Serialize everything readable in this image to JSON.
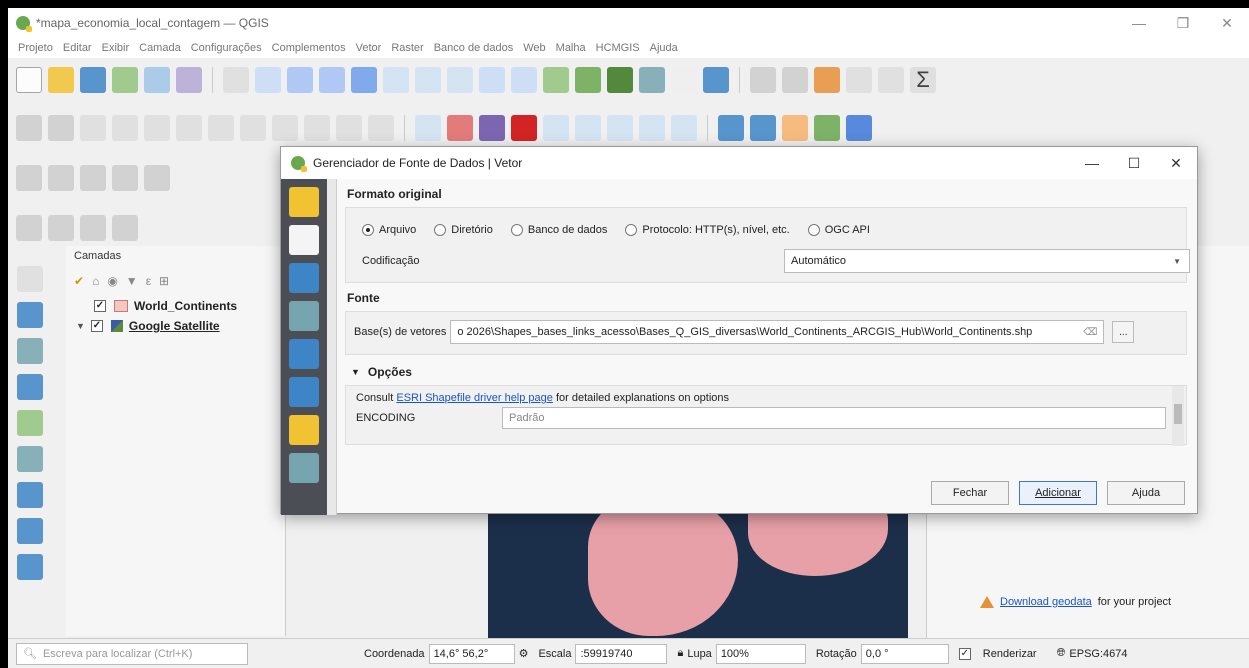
{
  "window": {
    "title": "*mapa_economia_local_contagem — QGIS"
  },
  "menu": [
    "Projeto",
    "Editar",
    "Exibir",
    "Camada",
    "Configurações",
    "Complementos",
    "Vetor",
    "Raster",
    "Banco de dados",
    "Web",
    "Malha",
    "HCMGIS",
    "Ajuda"
  ],
  "layers_panel": {
    "title": "Camadas",
    "layers": [
      {
        "name": "World_Continents",
        "checked": "✓"
      },
      {
        "name": "Google Satellite",
        "checked": "✓"
      }
    ]
  },
  "geodata": {
    "link": "Download geodata",
    "suffix": "for your project"
  },
  "statusbar": {
    "search_placeholder": "Escreva para localizar (Ctrl+K)",
    "coord_label": "Coordenada",
    "coord_value": "14,6° 56,2°",
    "scale_label": "Escala",
    "scale_value": ":59919740",
    "zoom_label": "Lupa",
    "zoom_value": "100%",
    "rotation_label": "Rotação",
    "rotation_value": "0,0 °",
    "render_label": "Renderizar",
    "crs": "EPSG:4674"
  },
  "dialog": {
    "title": "Gerenciador de Fonte de Dados | Vetor",
    "section_format": "Formato original",
    "radios": [
      {
        "label": "Arquivo",
        "selected": true
      },
      {
        "label": "Diretório",
        "selected": false
      },
      {
        "label": "Banco de dados",
        "selected": false
      },
      {
        "label": "Protocolo: HTTP(s), nível, etc.",
        "selected": false
      },
      {
        "label": "OGC API",
        "selected": false
      }
    ],
    "encoding_label": "Codificação",
    "encoding_value": "Automático",
    "section_source": "Fonte",
    "vector_label": "Base(s) de vetores",
    "vector_path": "o 2026\\Shapes_bases_links_acesso\\Bases_Q_GIS_diversas\\World_Continents_ARCGIS_Hub\\World_Continents.shp",
    "browse_label": "...",
    "options_title": "Opções",
    "consult_prefix": "Consult",
    "consult_link": "ESRI Shapefile driver help page",
    "consult_suffix": "for detailed explanations on options",
    "encoding_opt_label": "ENCODING",
    "encoding_opt_placeholder": "Padrão",
    "buttons": {
      "close": "Fechar",
      "add": "Adicionar",
      "help": "Ajuda"
    }
  },
  "colors": {
    "accent": "#3c78d8",
    "land": "#e8a0a8",
    "ocean": "#1c2f4a",
    "dialog_side": "#4b4f55"
  }
}
